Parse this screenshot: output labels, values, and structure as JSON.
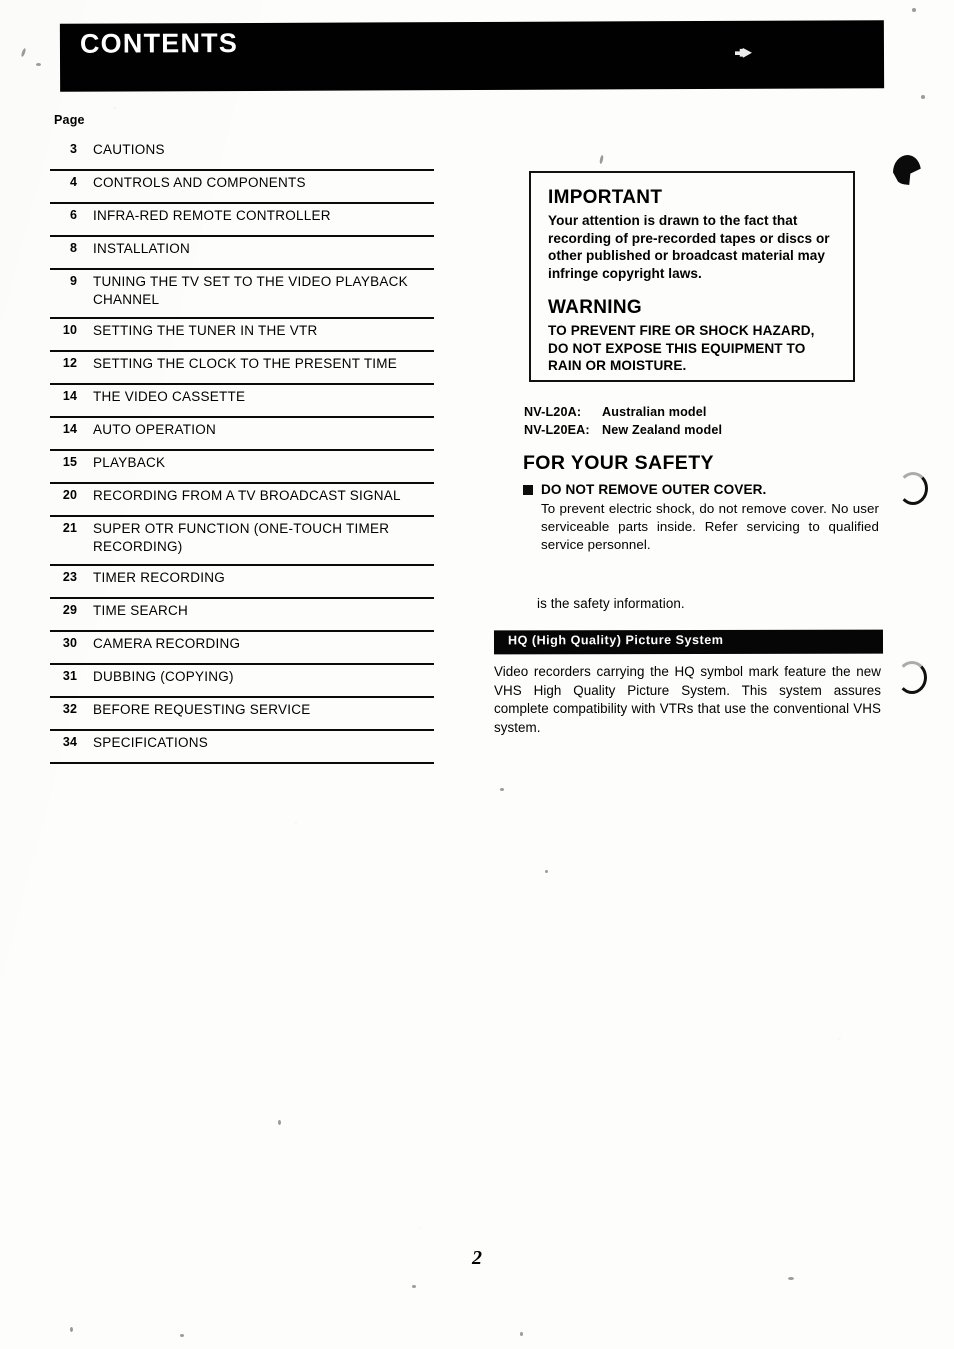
{
  "header": {
    "title": "CONTENTS"
  },
  "toc": {
    "page_label": "Page",
    "entries": [
      {
        "page": "3",
        "title": "CAUTIONS"
      },
      {
        "page": "4",
        "title": "CONTROLS AND COMPONENTS"
      },
      {
        "page": "6",
        "title": "INFRA-RED REMOTE CONTROLLER"
      },
      {
        "page": "8",
        "title": "INSTALLATION"
      },
      {
        "page": "9",
        "title": "TUNING THE TV SET TO THE VIDEO PLAYBACK CHANNEL"
      },
      {
        "page": "10",
        "title": "SETTING THE TUNER IN THE VTR"
      },
      {
        "page": "12",
        "title": "SETTING THE CLOCK TO THE PRESENT TIME"
      },
      {
        "page": "14",
        "title": "THE VIDEO CASSETTE"
      },
      {
        "page": "14",
        "title": "AUTO OPERATION"
      },
      {
        "page": "15",
        "title": "PLAYBACK"
      },
      {
        "page": "20",
        "title": "RECORDING FROM A TV BROADCAST SIGNAL"
      },
      {
        "page": "21",
        "title": "SUPER OTR FUNCTION (ONE-TOUCH TIMER RECORDING)"
      },
      {
        "page": "23",
        "title": "TIMER RECORDING"
      },
      {
        "page": "29",
        "title": "TIME SEARCH"
      },
      {
        "page": "30",
        "title": "CAMERA RECORDING"
      },
      {
        "page": "31",
        "title": "DUBBING (COPYING)"
      },
      {
        "page": "32",
        "title": "BEFORE REQUESTING SERVICE"
      },
      {
        "page": "34",
        "title": "SPECIFICATIONS"
      }
    ]
  },
  "notice_box": {
    "important_heading": "IMPORTANT",
    "important_body": "Your attention is drawn to the fact that recording of pre-recorded tapes or discs or other published or broadcast material may infringe copyright laws.",
    "warning_heading": "WARNING",
    "warning_body": "TO PREVENT FIRE OR SHOCK HAZARD, DO NOT EXPOSE THIS EQUIPMENT TO RAIN OR MOISTURE."
  },
  "models": [
    {
      "code": "NV-L20A:",
      "description": "Australian model"
    },
    {
      "code": "NV-L20EA:",
      "description": "New Zealand model"
    }
  ],
  "safety": {
    "heading": "FOR YOUR SAFETY",
    "item_title": "DO NOT REMOVE OUTER COVER.",
    "item_body": "To prevent electric shock, do not remove cover. No user serviceable parts inside. Refer servicing to qualified service personnel.",
    "note": "is the safety information."
  },
  "hq": {
    "bar_label": "HQ (High Quality) Picture System",
    "body": "Video recorders carrying the HQ symbol mark feature the new VHS High Quality Picture System. This system assures complete compatibility with VTRs that use the conventional VHS system."
  },
  "footer": {
    "page_number": "2"
  },
  "colors": {
    "ink": "#000000",
    "paper": "#fdfdfb",
    "bar_background": "#010101",
    "bar_text": "#ffffff"
  }
}
